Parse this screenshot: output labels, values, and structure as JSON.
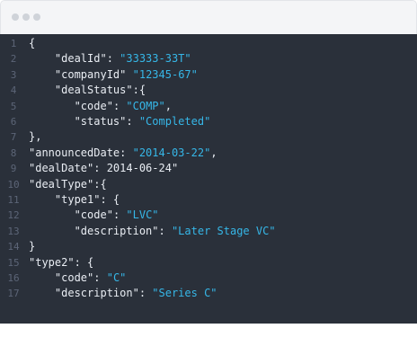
{
  "editor": {
    "lines": [
      {
        "n": "1",
        "indent": "",
        "tokens": [
          {
            "t": "{",
            "c": "punct"
          }
        ]
      },
      {
        "n": "2",
        "indent": "    ",
        "tokens": [
          {
            "t": "\"dealId\"",
            "c": "key"
          },
          {
            "t": ": ",
            "c": "punct"
          },
          {
            "t": "\"33333-33T\"",
            "c": "str"
          }
        ]
      },
      {
        "n": "3",
        "indent": "    ",
        "tokens": [
          {
            "t": "\"companyId\"",
            "c": "key"
          },
          {
            "t": " ",
            "c": "punct"
          },
          {
            "t": "\"12345-67\"",
            "c": "str"
          }
        ]
      },
      {
        "n": "4",
        "indent": "    ",
        "tokens": [
          {
            "t": "\"dealStatus\"",
            "c": "key"
          },
          {
            "t": ":{",
            "c": "punct"
          }
        ]
      },
      {
        "n": "5",
        "indent": "       ",
        "tokens": [
          {
            "t": "\"code\"",
            "c": "key"
          },
          {
            "t": ": ",
            "c": "punct"
          },
          {
            "t": "\"COMP\"",
            "c": "str"
          },
          {
            "t": ",",
            "c": "punct"
          }
        ]
      },
      {
        "n": "6",
        "indent": "       ",
        "tokens": [
          {
            "t": "\"status\"",
            "c": "key"
          },
          {
            "t": ": ",
            "c": "punct"
          },
          {
            "t": "\"Completed\"",
            "c": "str"
          }
        ]
      },
      {
        "n": "7",
        "indent": "",
        "tokens": [
          {
            "t": "},",
            "c": "punct"
          }
        ]
      },
      {
        "n": "8",
        "indent": "",
        "tokens": [
          {
            "t": "\"announcedDate",
            "c": "key"
          },
          {
            "t": ": ",
            "c": "punct"
          },
          {
            "t": "\"2014-03-22\"",
            "c": "str"
          },
          {
            "t": ",",
            "c": "punct"
          }
        ]
      },
      {
        "n": "9",
        "indent": "",
        "tokens": [
          {
            "t": "\"dealDate\"",
            "c": "key"
          },
          {
            "t": ": ",
            "c": "punct"
          },
          {
            "t": "2014-06-24\"",
            "c": "num"
          }
        ]
      },
      {
        "n": "10",
        "indent": "",
        "tokens": [
          {
            "t": "\"dealType\"",
            "c": "key"
          },
          {
            "t": ":{",
            "c": "punct"
          }
        ]
      },
      {
        "n": "11",
        "indent": "    ",
        "tokens": [
          {
            "t": "\"type1\"",
            "c": "key"
          },
          {
            "t": ": {",
            "c": "punct"
          }
        ]
      },
      {
        "n": "12",
        "indent": "       ",
        "tokens": [
          {
            "t": "\"code\"",
            "c": "key"
          },
          {
            "t": ": ",
            "c": "punct"
          },
          {
            "t": "\"LVC\"",
            "c": "str"
          }
        ]
      },
      {
        "n": "13",
        "indent": "       ",
        "tokens": [
          {
            "t": "\"description\"",
            "c": "key"
          },
          {
            "t": ": ",
            "c": "punct"
          },
          {
            "t": "\"Later Stage VC\"",
            "c": "str"
          }
        ]
      },
      {
        "n": "14",
        "indent": "",
        "tokens": [
          {
            "t": "}",
            "c": "punct"
          }
        ]
      },
      {
        "n": "15",
        "indent": "",
        "tokens": [
          {
            "t": "\"type2\"",
            "c": "key"
          },
          {
            "t": ": {",
            "c": "punct"
          }
        ]
      },
      {
        "n": "16",
        "indent": "    ",
        "tokens": [
          {
            "t": "\"code\"",
            "c": "key"
          },
          {
            "t": ": ",
            "c": "punct"
          },
          {
            "t": "\"C\"",
            "c": "str"
          }
        ]
      },
      {
        "n": "17",
        "indent": "    ",
        "tokens": [
          {
            "t": "\"description\"",
            "c": "key"
          },
          {
            "t": ": ",
            "c": "punct"
          },
          {
            "t": "\"Series C\"",
            "c": "str"
          }
        ]
      }
    ]
  },
  "colors": {
    "editor_bg": "#2a303a",
    "string": "#36b7e8",
    "text": "#e9edf3",
    "line_number": "#5c6577",
    "titlebar": "#f4f5f7"
  }
}
